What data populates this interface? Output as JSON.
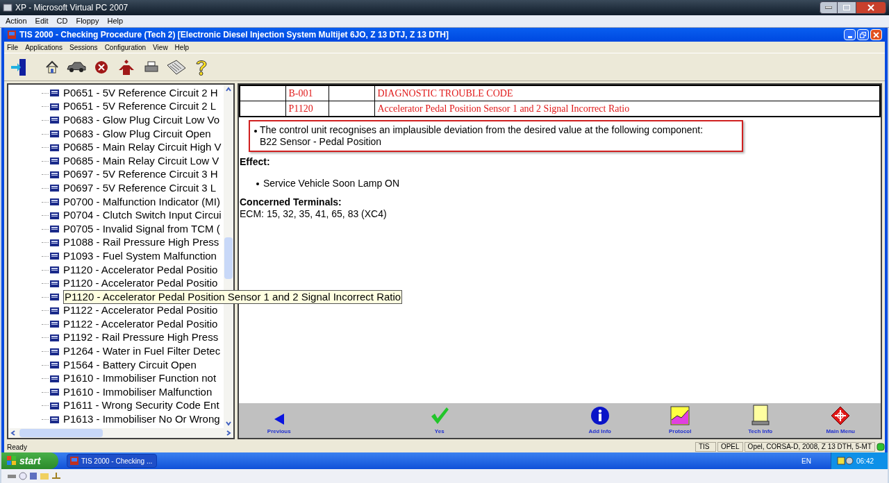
{
  "host_window": {
    "title": "XP - Microsoft Virtual PC 2007",
    "menu": [
      "Action",
      "Edit",
      "CD",
      "Floppy",
      "Help"
    ]
  },
  "app_window": {
    "title": "TIS 2000 - Checking Procedure (Tech 2) [Electronic Diesel Injection System Multijet 6JO, Z 13 DTJ, Z 13 DTH]",
    "menu": [
      "File",
      "Applications",
      "Sessions",
      "Configuration",
      "View",
      "Help"
    ]
  },
  "tree": {
    "items": [
      {
        "label": "P0651 - 5V Reference Circuit 2 H",
        "selected": false
      },
      {
        "label": "P0651 - 5V Reference Circuit 2 L",
        "selected": false
      },
      {
        "label": "P0683 - Glow Plug Circuit Low Vo",
        "selected": false
      },
      {
        "label": "P0683 - Glow Plug Circuit Open",
        "selected": false
      },
      {
        "label": "P0685 - Main Relay Circuit High V",
        "selected": false
      },
      {
        "label": "P0685 - Main Relay Circuit Low V",
        "selected": false
      },
      {
        "label": "P0697 - 5V Reference Circuit 3 H",
        "selected": false
      },
      {
        "label": "P0697 - 5V Reference Circuit 3 L",
        "selected": false
      },
      {
        "label": "P0700 - Malfunction Indicator (MI)",
        "selected": false
      },
      {
        "label": "P0704 - Clutch Switch Input Circui",
        "selected": false
      },
      {
        "label": "P0705 - Invalid Signal from TCM (",
        "selected": false
      },
      {
        "label": "P1088 - Rail Pressure High Press",
        "selected": false
      },
      {
        "label": "P1093 - Fuel System Malfunction",
        "selected": false
      },
      {
        "label": "P1120 - Accelerator Pedal Positio",
        "selected": false
      },
      {
        "label": "P1120 - Accelerator Pedal Positio",
        "selected": false
      },
      {
        "label": "P1120 - Accelerator Pedal Position Sensor 1 and 2 Signal Incorrect Ratio",
        "selected": true
      },
      {
        "label": "P1122 - Accelerator Pedal Positio",
        "selected": false
      },
      {
        "label": "P1122 - Accelerator Pedal Positio",
        "selected": false
      },
      {
        "label": "P1192 - Rail Pressure High Press",
        "selected": false
      },
      {
        "label": "P1264 - Water in Fuel Filter Detec",
        "selected": false
      },
      {
        "label": "P1564 - Battery Circuit Open",
        "selected": false
      },
      {
        "label": "P1610 - Immobiliser Function not",
        "selected": false
      },
      {
        "label": "P1610 - Immobiliser Malfunction",
        "selected": false
      },
      {
        "label": "P1611 - Wrong Security Code Ent",
        "selected": false
      },
      {
        "label": "P1613 - Immobiliser No Or Wrong",
        "selected": false
      }
    ]
  },
  "content": {
    "table": {
      "rows": [
        {
          "code": "B-001",
          "description": "DIAGNOSTIC TROUBLE CODE"
        },
        {
          "code": "P1120",
          "description": "Accelerator Pedal Position Sensor 1 and 2 Signal Incorrect Ratio"
        }
      ]
    },
    "highlighted_note": {
      "text": "The control unit recognises an implausible deviation from the desired value at the following component:",
      "component": "B22 Sensor - Pedal Position"
    },
    "sections": [
      {
        "heading": "Effect:",
        "bullets": [
          "Service Vehicle Soon Lamp ON"
        ]
      },
      {
        "heading": "Concerned Terminals:",
        "text": "ECM: 15, 32, 35, 41, 65, 83 (XC4)"
      }
    ]
  },
  "nav_buttons": [
    {
      "label": "Previous",
      "kind": "previous"
    },
    {
      "label": "Yes",
      "kind": "yes"
    },
    {
      "label": "Add Info",
      "kind": "info"
    },
    {
      "label": "Protocol",
      "kind": "protocol"
    },
    {
      "label": "Tech Info",
      "kind": "techinfo"
    },
    {
      "label": "Main Menu",
      "kind": "mainmenu"
    }
  ],
  "status_bar": {
    "text": "Ready",
    "panels": [
      "TIS",
      "OPEL",
      "Opel, CORSA-D, 2008, Z 13 DTH, 5-MT"
    ]
  },
  "taskbar": {
    "start": "start",
    "tasks": [
      "TIS 2000 - Checking ..."
    ],
    "language": "EN",
    "clock": "06:42"
  }
}
